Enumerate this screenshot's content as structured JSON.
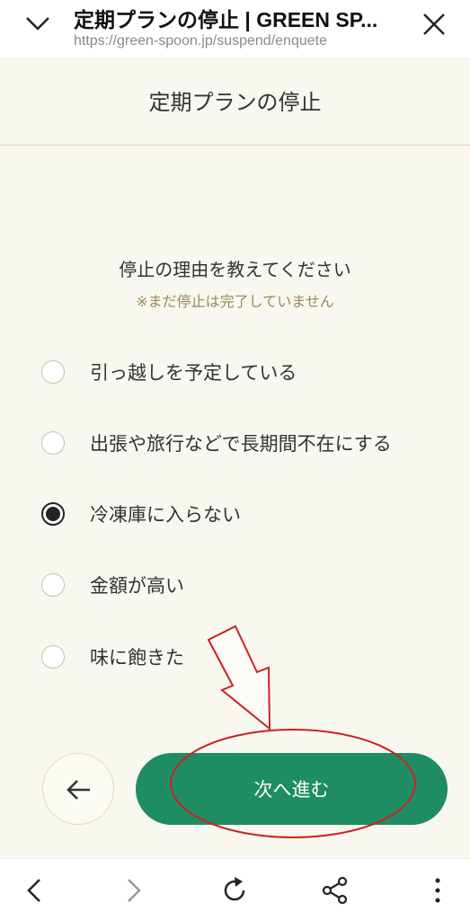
{
  "browser": {
    "title": "定期プランの停止 | GREEN SP...",
    "url": "https://green-spoon.jp/suspend/enquete"
  },
  "page": {
    "title": "定期プランの停止",
    "question": "停止の理由を教えてください",
    "note": "※まだ停止は完了していません"
  },
  "options": [
    {
      "label": "引っ越しを予定している",
      "checked": false
    },
    {
      "label": "出張や旅行などで長期間不在にする",
      "checked": false
    },
    {
      "label": "冷凍庫に入らない",
      "checked": true
    },
    {
      "label": "金額が高い",
      "checked": false
    },
    {
      "label": "味に飽きた",
      "checked": false
    }
  ],
  "buttons": {
    "next_label": "次へ進む"
  },
  "colors": {
    "accent": "#1f8d62",
    "annotation": "#cc2222",
    "background": "#f8f7f0"
  }
}
